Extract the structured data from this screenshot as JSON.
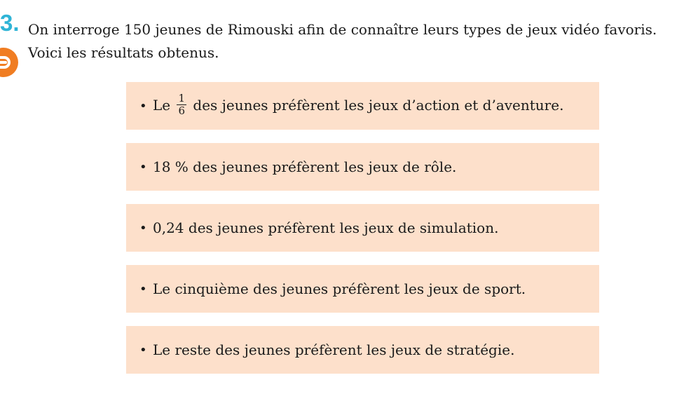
{
  "colors": {
    "accent_blue": "#2fb4d6",
    "accent_orange": "#f07d22",
    "box_background": "#fde0cb"
  },
  "question": {
    "number": "3.",
    "icon": "orange-circle-icon",
    "intro_line_1": "On interroge 150 jeunes de Rimouski afin de connaître leurs types de jeux vidéo favoris.",
    "intro_line_2": "Voici les résultats obtenus."
  },
  "items": [
    {
      "bullet": "•",
      "before": "Le",
      "fraction_numerator": "1",
      "fraction_denominator": "6",
      "after": "des jeunes préfèrent les jeux d’action et d’aventure."
    },
    {
      "bullet": "•",
      "text": "18 % des jeunes préfèrent les jeux de rôle."
    },
    {
      "bullet": "•",
      "text": "0,24 des jeunes préfèrent les jeux de simulation."
    },
    {
      "bullet": "•",
      "text": "Le cinquième des jeunes préfèrent les jeux de sport."
    },
    {
      "bullet": "•",
      "text": "Le reste des jeunes préfèrent les jeux de stratégie."
    }
  ]
}
